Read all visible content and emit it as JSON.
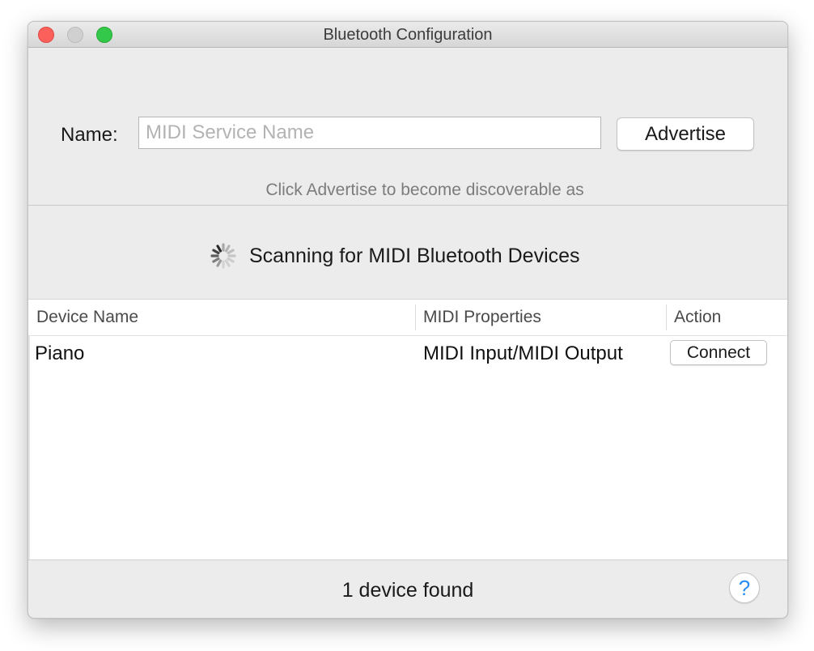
{
  "window": {
    "title": "Bluetooth Configuration"
  },
  "advertise": {
    "name_label": "Name:",
    "name_value": "",
    "name_placeholder": "MIDI Service Name",
    "button_label": "Advertise",
    "hint": "Click Advertise to become discoverable as"
  },
  "scan": {
    "status": "Scanning for MIDI Bluetooth Devices",
    "icon": "spinner-icon"
  },
  "table": {
    "columns": [
      "Device Name",
      "MIDI Properties",
      "Action"
    ],
    "rows": [
      {
        "device_name": "Piano",
        "properties": "MIDI Input/MIDI Output",
        "action": "Connect"
      }
    ]
  },
  "footer": {
    "status": "1 device found",
    "help_label": "?"
  },
  "colors": {
    "close": "#fc605b",
    "minimize": "#d0d0d0",
    "zoom": "#34c84a",
    "help_accent": "#2a8cf0"
  }
}
